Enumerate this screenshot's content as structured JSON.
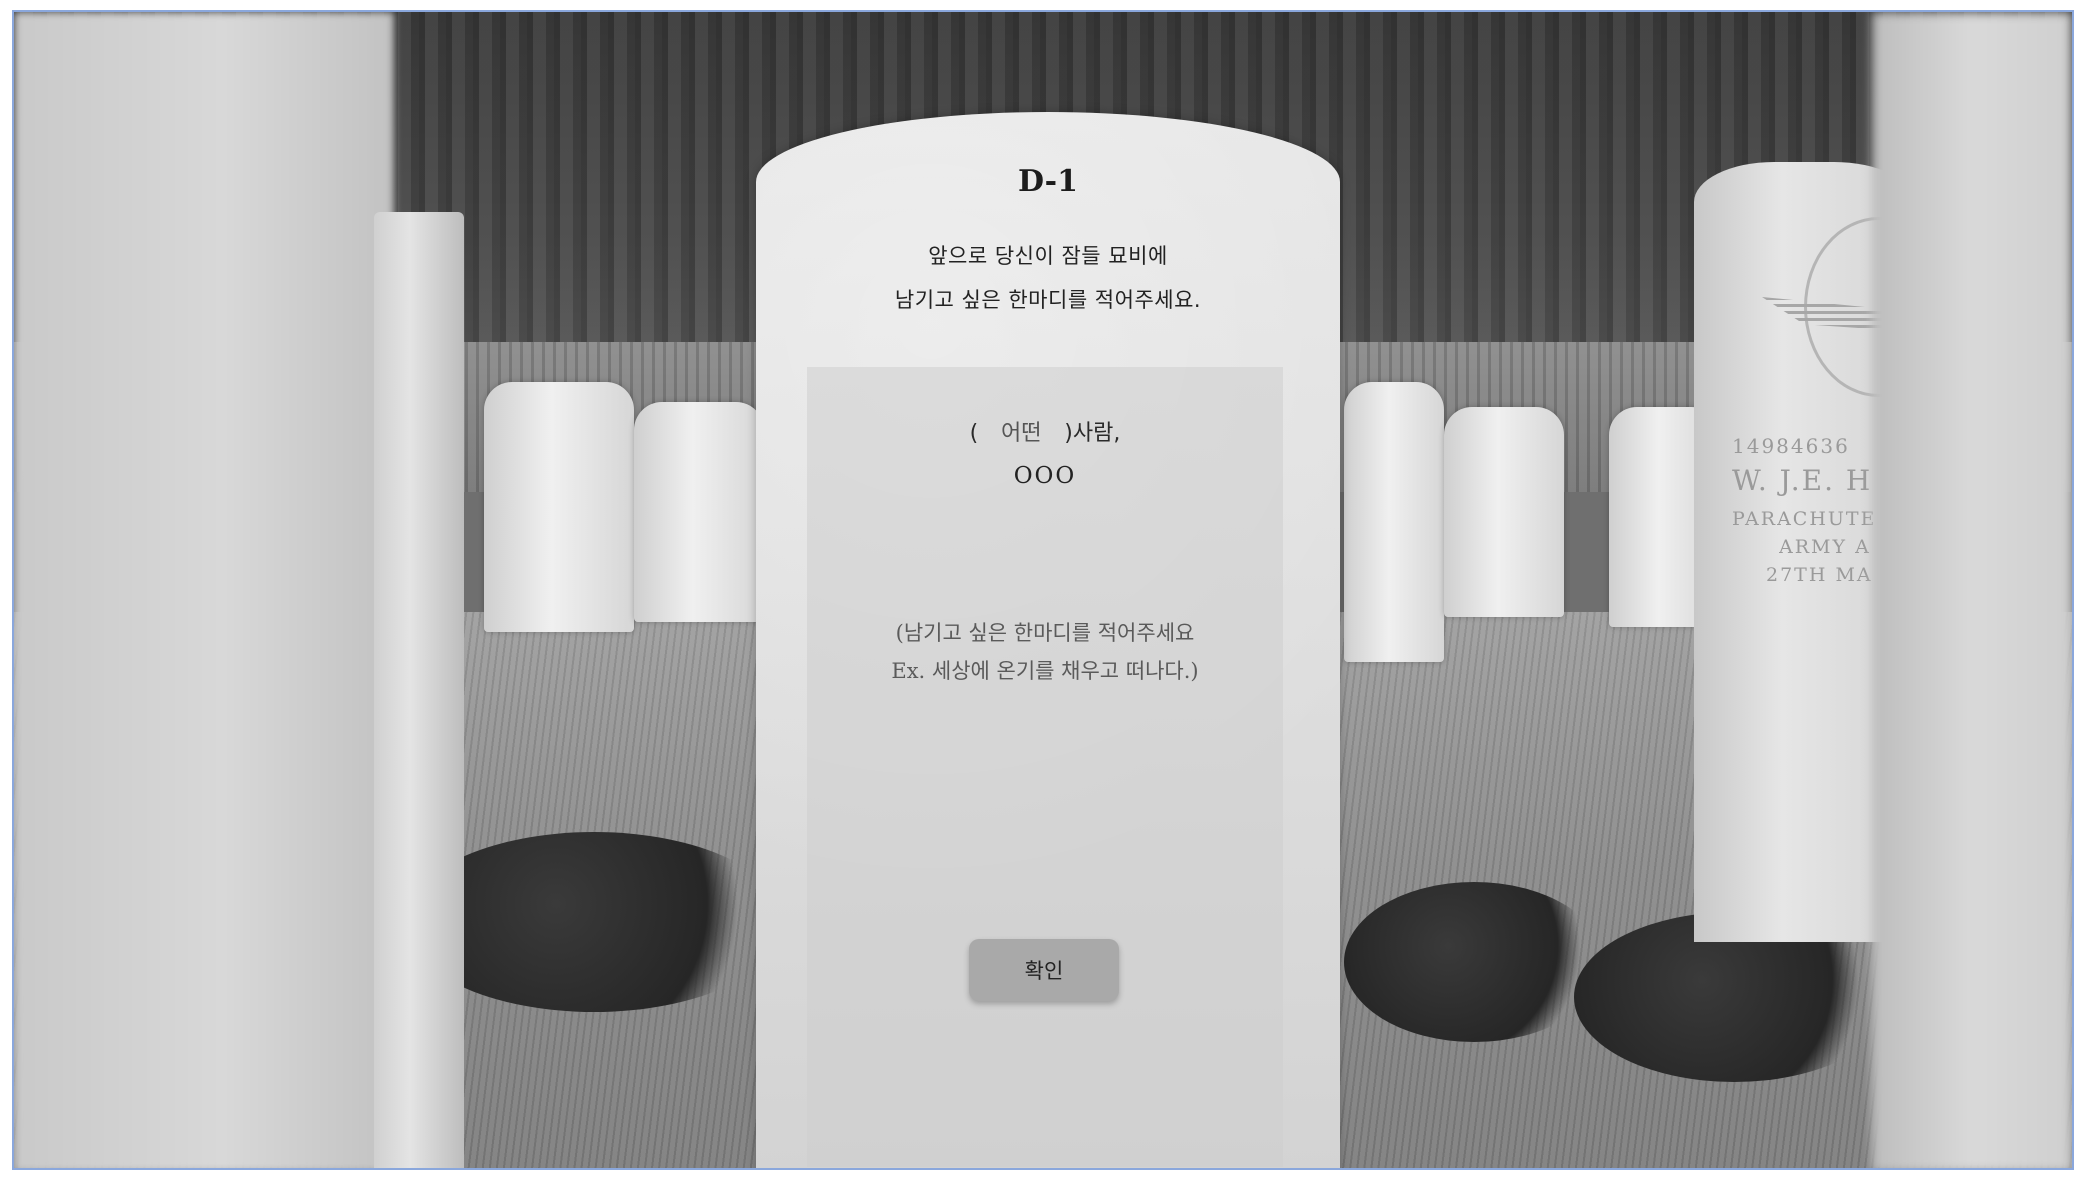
{
  "tombstone": {
    "title": "D-1",
    "description_line1": "앞으로 당신이 잠들 묘비에",
    "description_line2": "남기고 싶은 한마디를 적어주세요."
  },
  "form": {
    "prefix_open": "(",
    "adjective_placeholder": "어떤",
    "suffix": ")사람,",
    "name_placeholder": "OOO",
    "message_placeholder_line1": "(남기고 싶은 한마디를 적어주세요",
    "message_placeholder_line2": "Ex. 세상에 온기를 채우고 떠나다.)",
    "confirm_label": "확인"
  },
  "background_stone": {
    "line1": "14984636",
    "line2": "W. J.E. H",
    "line3": "PARACHUTE",
    "line4": "ARMY A",
    "line5": "27TH MA"
  }
}
